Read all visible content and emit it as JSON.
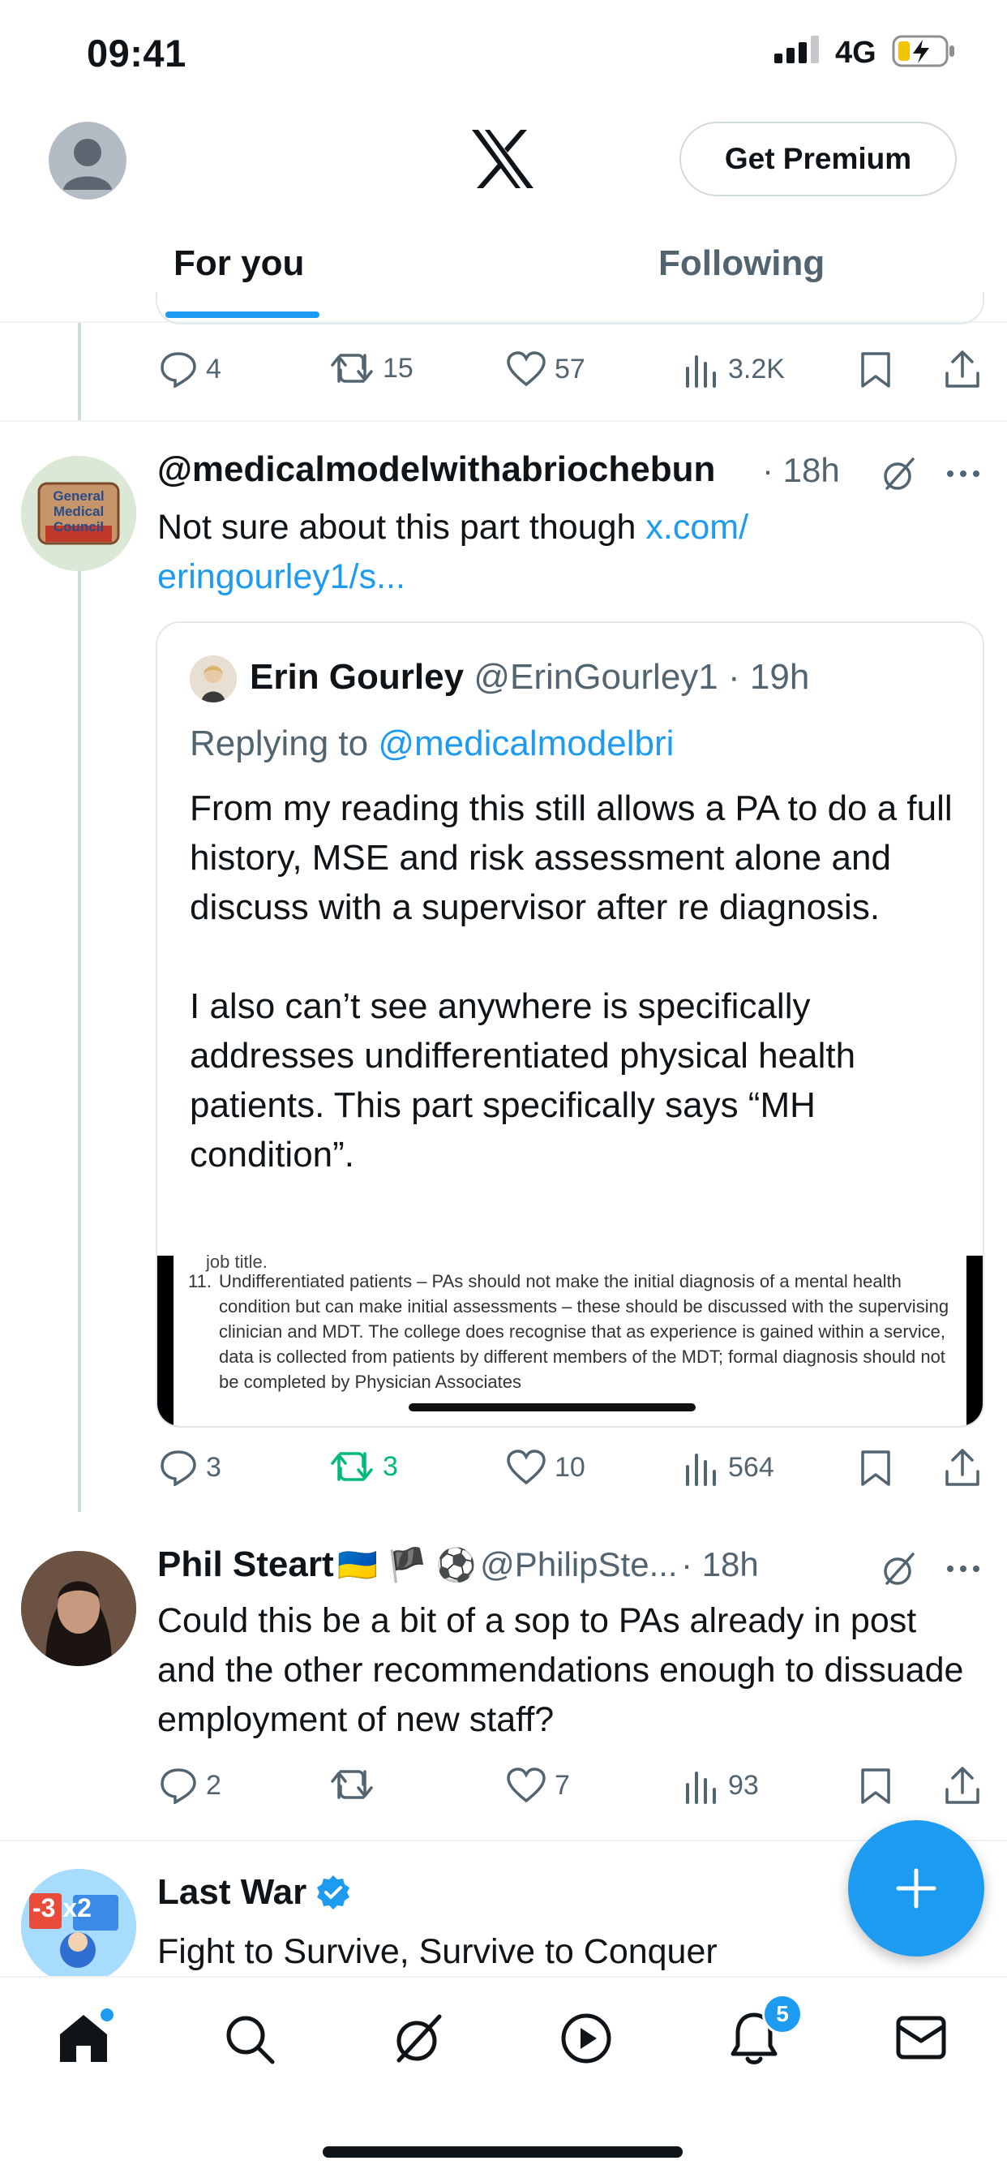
{
  "status_bar": {
    "time": "09:41",
    "network": "4G"
  },
  "header": {
    "premium_label": "Get Premium"
  },
  "tabs": [
    {
      "label": "For you"
    },
    {
      "label": "Following"
    }
  ],
  "top_actions": {
    "replies": "4",
    "reposts": "15",
    "likes": "57",
    "views": "3.2K"
  },
  "tweet1": {
    "handle": "@medicalmodelwithabriochebun",
    "time": "· 18h",
    "text": "Not sure about this part though ",
    "link": "x.com/\neringourley1/s...",
    "avatar_text": "General Medical Council",
    "quote": {
      "name": "Erin Gourley",
      "handle": "@ErinGourley1",
      "time": "· 19h",
      "replying_prefix": "Replying to ",
      "replying_handle": "@medicalmodelbri",
      "text": "From my reading this still allows a PA to do a full history, MSE and risk assessment alone and discuss with a supervisor after re diagnosis.\n\nI also can’t see anywhere is specifically addresses undifferentiated physical health patients. This part specifically says “MH condition”.",
      "image_text": {
        "line0": "job title.",
        "number": "11.",
        "body": "Undifferentiated patients – PAs should not make the initial diagnosis of a mental health condition but can make initial assessments – these should be discussed with the supervising clinician and MDT. The college does recognise that as experience is gained within a service, data is collected from patients by different members of the MDT; formal diagnosis should not be completed by Physician Associates"
      }
    },
    "actions": {
      "replies": "3",
      "reposts": "3",
      "likes": "10",
      "views": "564"
    }
  },
  "tweet2": {
    "name": "Phil Steart",
    "flags": "🇺🇦 🏴 ⚽",
    "handle": "@PhilipSte...",
    "time": "· 18h",
    "text": "Could this be a bit of a sop to PAs already in post and the other recommendations enough to dissuade employment of new staff?",
    "actions": {
      "replies": "2",
      "reposts": "",
      "likes": "7",
      "views": "93"
    }
  },
  "tweet3": {
    "name": "Last War",
    "text": "Fight to Survive, Survive to Conquer",
    "avatar_text": "-3 x2"
  },
  "nav": {
    "notifications_count": "5"
  },
  "colors": {
    "accent": "#1d9bf0",
    "repost_active": "#00ba7c",
    "text": "#0f1419",
    "muted": "#536471"
  }
}
